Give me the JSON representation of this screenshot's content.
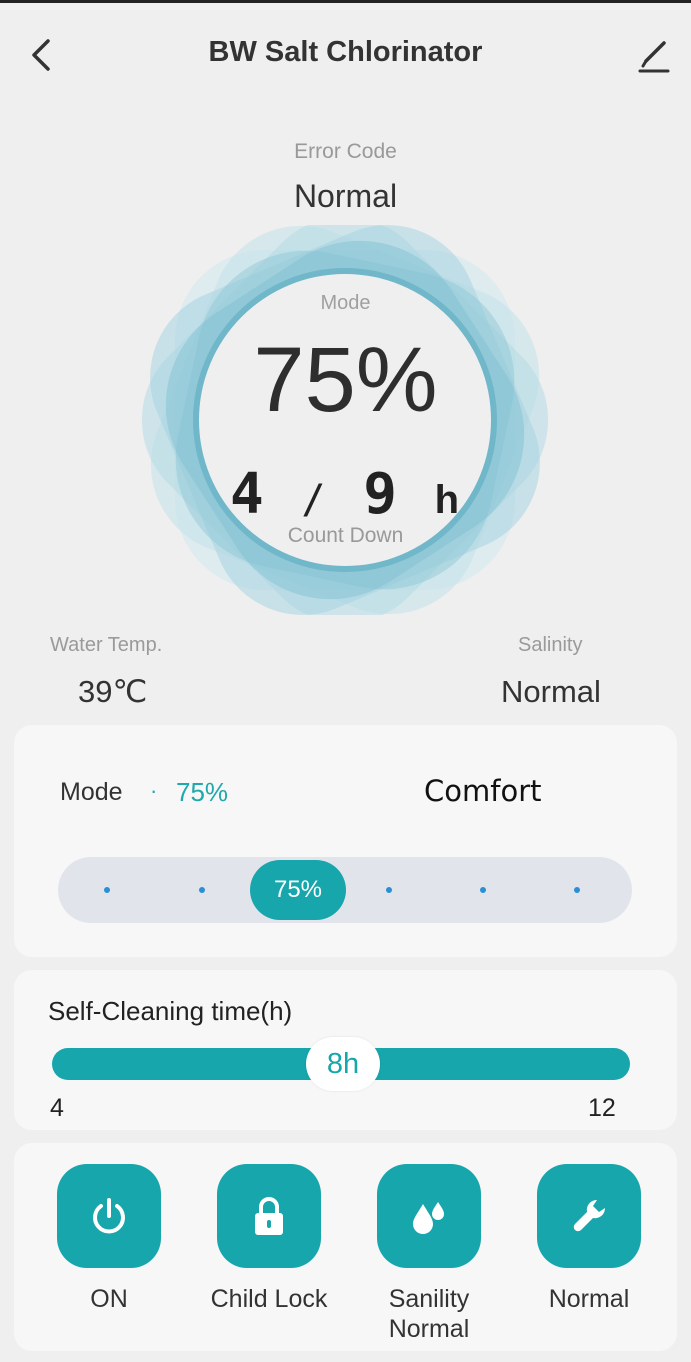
{
  "header": {
    "title": "BW Salt Chlorinator"
  },
  "error": {
    "label": "Error Code",
    "value": "Normal"
  },
  "gauge": {
    "mode_label": "Mode",
    "percent": "75%",
    "countdown_current": "4",
    "countdown_separator": "/",
    "countdown_total": "9",
    "countdown_unit": "h",
    "countdown_label": "Count Down"
  },
  "stats": {
    "water_temp_label": "Water Temp.",
    "water_temp_value": "39℃",
    "salinity_label": "Salinity",
    "salinity_value": "Normal"
  },
  "mode_card": {
    "label": "Mode",
    "dot": "·",
    "value": "75%",
    "name": "Comfort",
    "selected_label": "75%",
    "steps": 6,
    "selected_index": 2
  },
  "clean_card": {
    "label": "Self-Cleaning time(h)",
    "value_label": "8h",
    "value": 8,
    "min": "4",
    "max": "12"
  },
  "actions": [
    {
      "icon": "power-icon",
      "label": "ON"
    },
    {
      "icon": "lock-icon",
      "label": "Child Lock"
    },
    {
      "icon": "drops-icon",
      "label": "Sanility\nNormal"
    },
    {
      "icon": "wrench-icon",
      "label": "Normal"
    }
  ],
  "colors": {
    "accent": "#17a6ac",
    "background": "#efefef",
    "card": "#f7f7f7",
    "track": "#e1e5eb"
  }
}
